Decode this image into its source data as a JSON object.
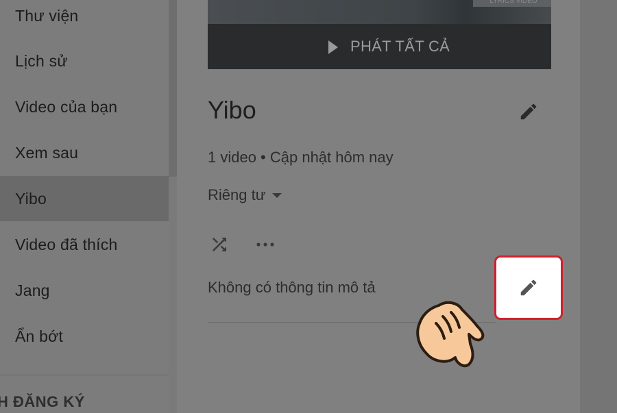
{
  "sidebar": {
    "items": [
      {
        "label": "Thư viện"
      },
      {
        "label": "Lịch sử"
      },
      {
        "label": "Video của bạn"
      },
      {
        "label": "Xem sau"
      },
      {
        "label": "Yibo",
        "active": true
      },
      {
        "label": "Video đã thích"
      },
      {
        "label": "Jang"
      },
      {
        "label": "Ẩn bớt"
      }
    ],
    "section_title": "H ĐĂNG KÝ"
  },
  "playlist": {
    "thumbnail_tag": "LYRICS VIDEO",
    "play_all_label": "PHÁT TẤT CẢ",
    "title": "Yibo",
    "meta": "1 video • Cập nhật hôm nay",
    "privacy": "Riêng tư",
    "description": "Không có thông tin mô tả"
  },
  "icons": {
    "edit_title": "pencil-icon",
    "shuffle": "shuffle-icon",
    "more": "more-horiz-icon",
    "edit_description": "pencil-icon",
    "hand": "pointing-hand-icon"
  },
  "colors": {
    "highlight_border": "#d0202c",
    "hand_fill": "#f7c99a"
  }
}
